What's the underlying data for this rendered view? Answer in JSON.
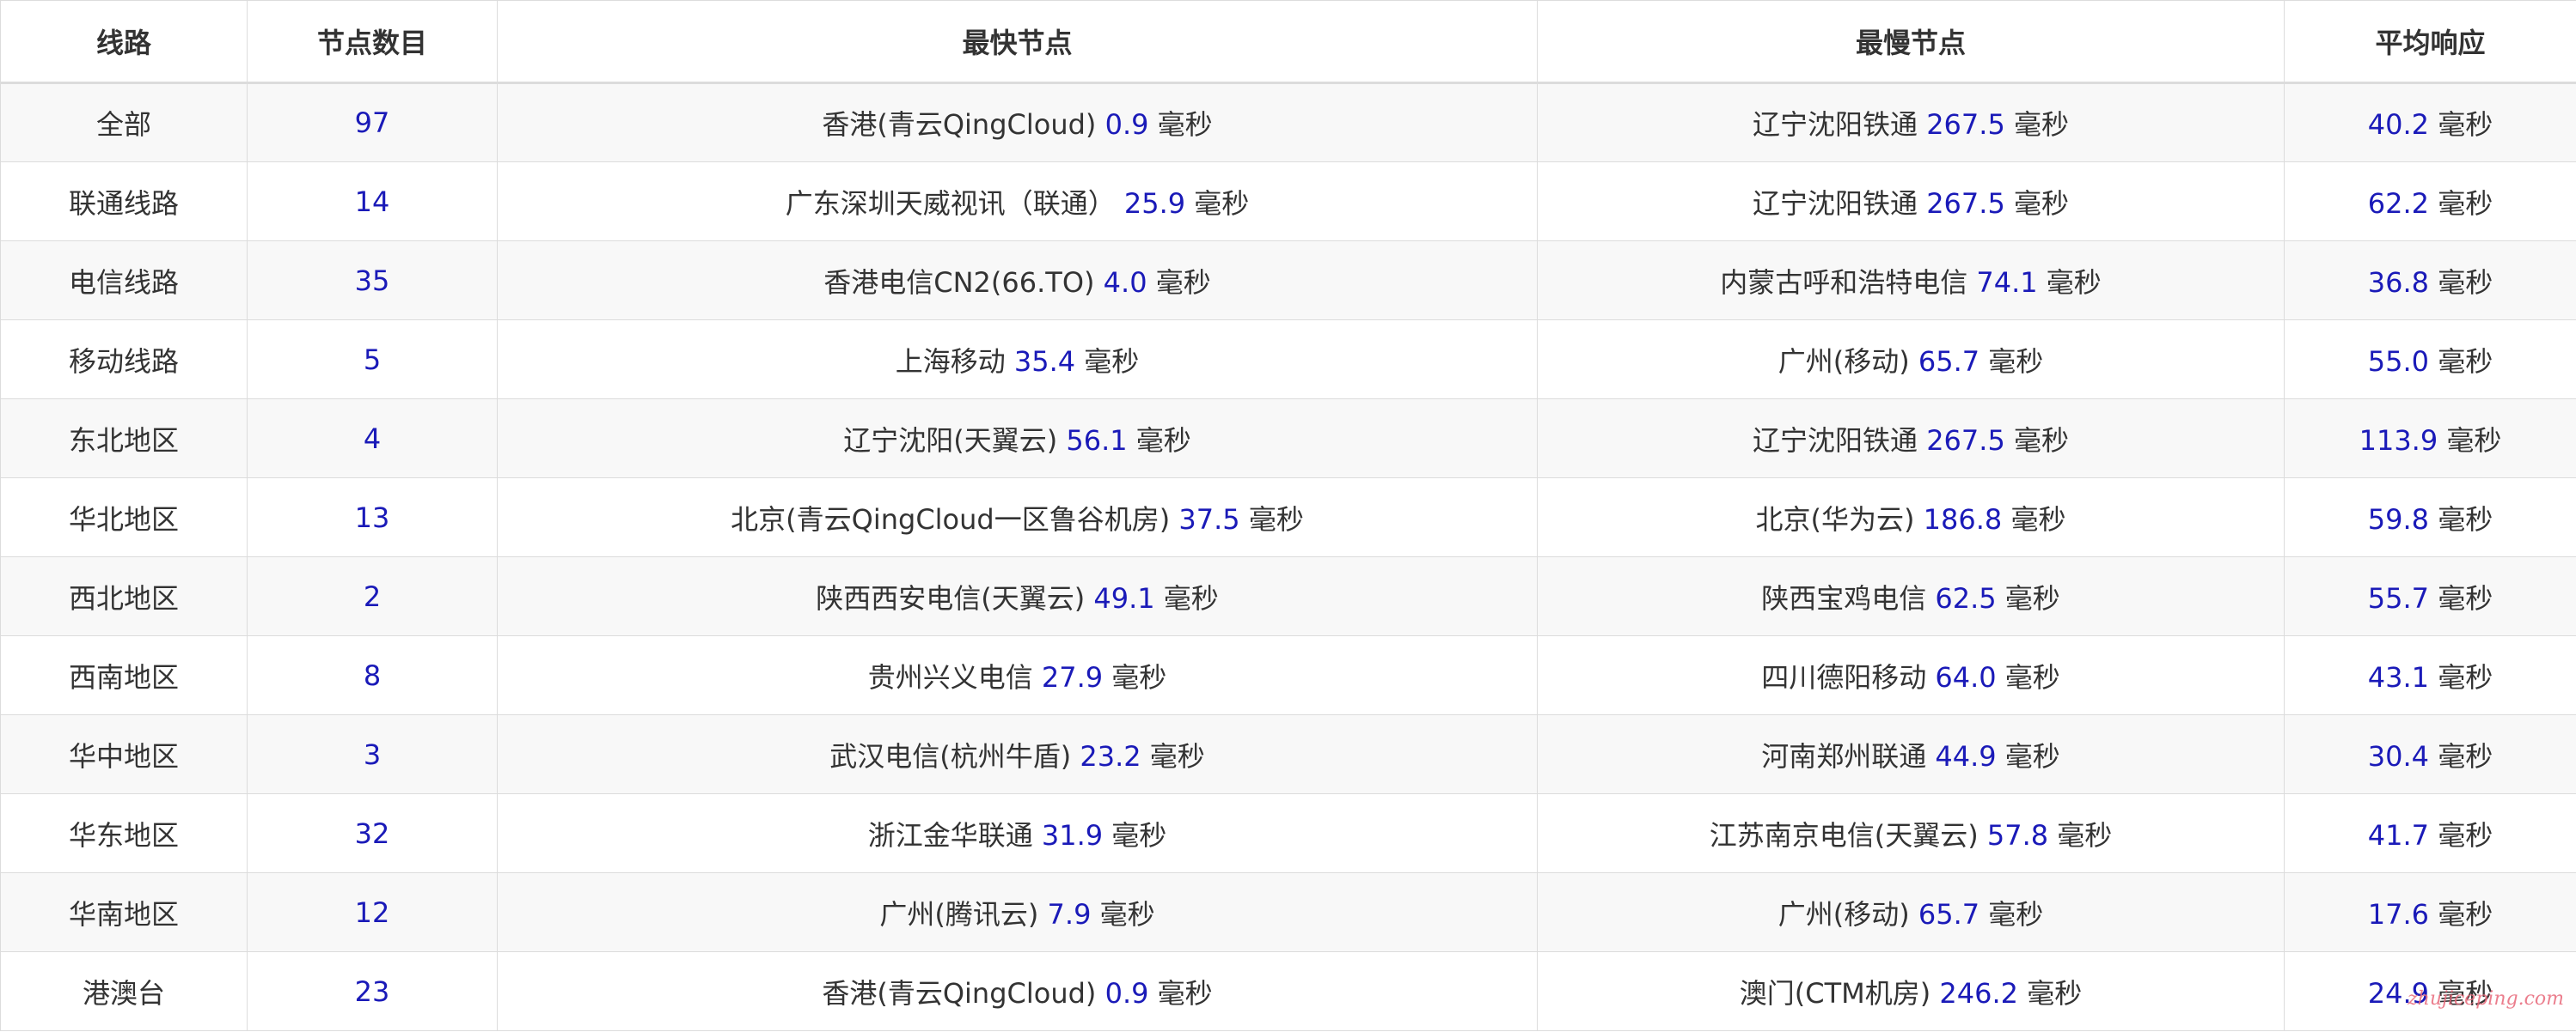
{
  "headers": {
    "route": "线路",
    "count": "节点数目",
    "fastest": "最快节点",
    "slowest": "最慢节点",
    "average": "平均响应"
  },
  "unit": "毫秒",
  "rows": [
    {
      "route": "全部",
      "count": "97",
      "fastest_name": "香港(青云QingCloud)",
      "fastest_ms": "0.9",
      "slowest_name": "辽宁沈阳铁通",
      "slowest_ms": "267.5",
      "avg_ms": "40.2"
    },
    {
      "route": "联通线路",
      "count": "14",
      "fastest_name": "广东深圳天威视讯（联通）",
      "fastest_ms": "25.9",
      "slowest_name": "辽宁沈阳铁通",
      "slowest_ms": "267.5",
      "avg_ms": "62.2"
    },
    {
      "route": "电信线路",
      "count": "35",
      "fastest_name": "香港电信CN2(66.TO)",
      "fastest_ms": "4.0",
      "slowest_name": "内蒙古呼和浩特电信",
      "slowest_ms": "74.1",
      "avg_ms": "36.8"
    },
    {
      "route": "移动线路",
      "count": "5",
      "fastest_name": "上海移动",
      "fastest_ms": "35.4",
      "slowest_name": "广州(移动)",
      "slowest_ms": "65.7",
      "avg_ms": "55.0"
    },
    {
      "route": "东北地区",
      "count": "4",
      "fastest_name": "辽宁沈阳(天翼云)",
      "fastest_ms": "56.1",
      "slowest_name": "辽宁沈阳铁通",
      "slowest_ms": "267.5",
      "avg_ms": "113.9"
    },
    {
      "route": "华北地区",
      "count": "13",
      "fastest_name": "北京(青云QingCloud一区鲁谷机房)",
      "fastest_ms": "37.5",
      "slowest_name": "北京(华为云)",
      "slowest_ms": "186.8",
      "avg_ms": "59.8"
    },
    {
      "route": "西北地区",
      "count": "2",
      "fastest_name": "陕西西安电信(天翼云)",
      "fastest_ms": "49.1",
      "slowest_name": "陕西宝鸡电信",
      "slowest_ms": "62.5",
      "avg_ms": "55.7"
    },
    {
      "route": "西南地区",
      "count": "8",
      "fastest_name": "贵州兴义电信",
      "fastest_ms": "27.9",
      "slowest_name": "四川德阳移动",
      "slowest_ms": "64.0",
      "avg_ms": "43.1"
    },
    {
      "route": "华中地区",
      "count": "3",
      "fastest_name": "武汉电信(杭州牛盾)",
      "fastest_ms": "23.2",
      "slowest_name": "河南郑州联通",
      "slowest_ms": "44.9",
      "avg_ms": "30.4"
    },
    {
      "route": "华东地区",
      "count": "32",
      "fastest_name": "浙江金华联通",
      "fastest_ms": "31.9",
      "slowest_name": "江苏南京电信(天翼云)",
      "slowest_ms": "57.8",
      "avg_ms": "41.7"
    },
    {
      "route": "华南地区",
      "count": "12",
      "fastest_name": "广州(腾讯云)",
      "fastest_ms": "7.9",
      "slowest_name": "广州(移动)",
      "slowest_ms": "65.7",
      "avg_ms": "17.6"
    },
    {
      "route": "港澳台",
      "count": "23",
      "fastest_name": "香港(青云QingCloud)",
      "fastest_ms": "0.9",
      "slowest_name": "澳门(CTM机房)",
      "slowest_ms": "246.2",
      "avg_ms": "24.9"
    }
  ],
  "watermark": "zhujiceping.com",
  "colors": {
    "value_blue": "#1a1ab8",
    "text": "#333333",
    "row_stripe": "#f8f8f8",
    "border": "#dcdcdc",
    "watermark": "#e8687a"
  }
}
